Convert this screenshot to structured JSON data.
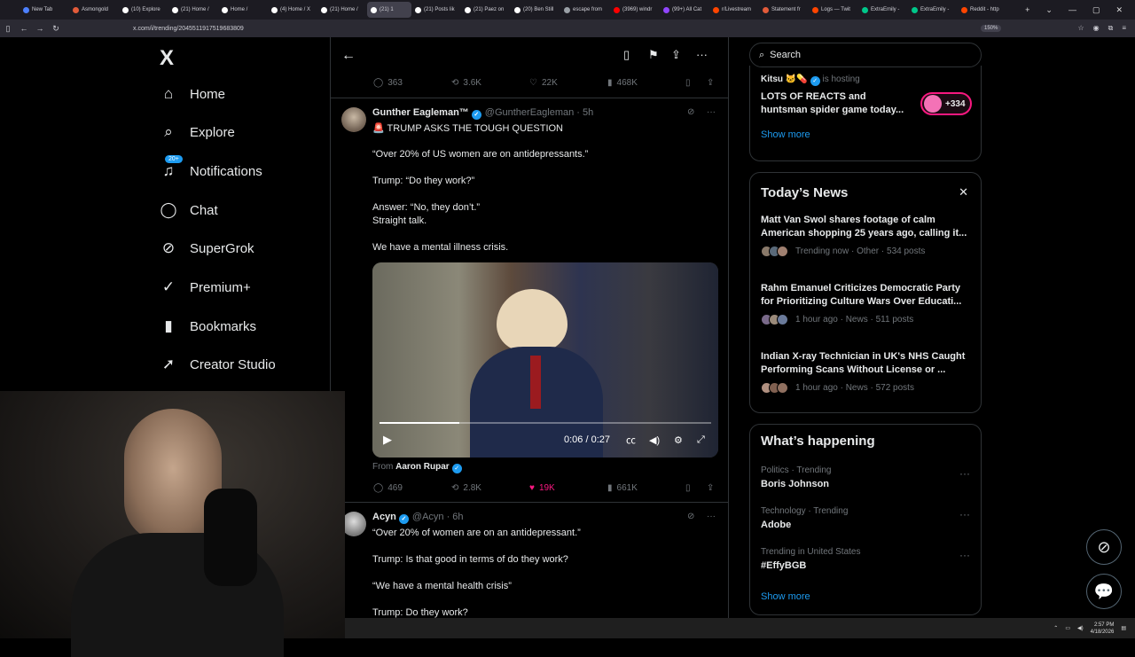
{
  "browser": {
    "tabs": [
      {
        "label": "New Tab",
        "color": "#4d80ff"
      },
      {
        "label": "Asmongold",
        "color": "#e25b3a"
      },
      {
        "label": "(10) Explore",
        "color": "#ffffff"
      },
      {
        "label": "(21) Home /",
        "color": "#ffffff"
      },
      {
        "label": "Home /",
        "color": "#ffffff"
      },
      {
        "label": "(4) Home / X",
        "color": "#ffffff"
      },
      {
        "label": "(21) Home /",
        "color": "#ffffff"
      },
      {
        "label": "(21) 1",
        "color": "#ffffff",
        "active": true
      },
      {
        "label": "(21) Posts lik",
        "color": "#ffffff"
      },
      {
        "label": "(21) Paez on",
        "color": "#ffffff"
      },
      {
        "label": "(20) Ben Still",
        "color": "#ffffff"
      },
      {
        "label": "escape from",
        "color": "#9aa0a6"
      },
      {
        "label": "(3969) windr",
        "color": "#ff0000"
      },
      {
        "label": "(99+) All Cat",
        "color": "#9146ff"
      },
      {
        "label": "r/Livestream",
        "color": "#ff4500"
      },
      {
        "label": "Statement fr",
        "color": "#e25b3a"
      },
      {
        "label": "Logs — Twit",
        "color": "#ff4500"
      },
      {
        "label": "ExtraEmily -",
        "color": "#00c78a"
      },
      {
        "label": "ExtraEmily -",
        "color": "#00c78a"
      },
      {
        "label": "Reddit - http",
        "color": "#ff4500"
      }
    ],
    "url": "x.com/i/trending/2045511917519683809",
    "zoom": "150%"
  },
  "nav": {
    "logo": "X",
    "items": [
      {
        "label": "Home",
        "icon": "home-icon",
        "glyph": "⌂"
      },
      {
        "label": "Explore",
        "icon": "search-icon",
        "glyph": "⌕"
      },
      {
        "label": "Notifications",
        "icon": "bell-icon",
        "glyph": "♫",
        "badge": "20+"
      },
      {
        "label": "Chat",
        "icon": "chat-icon",
        "glyph": "◯"
      },
      {
        "label": "SuperGrok",
        "icon": "grok-icon",
        "glyph": "⊘"
      },
      {
        "label": "Premium+",
        "icon": "premium-icon",
        "glyph": "✓"
      },
      {
        "label": "Bookmarks",
        "icon": "bookmark-icon",
        "glyph": "▮"
      },
      {
        "label": "Creator Studio",
        "icon": "rocket-icon",
        "glyph": "➚"
      }
    ]
  },
  "prev_tweet_stats": {
    "replies": "363",
    "reposts": "3.6K",
    "likes": "22K",
    "views": "468K"
  },
  "tweet1": {
    "name": "Gunther Eagleman™",
    "handle": "@GuntherEagleman · 5h",
    "lines": [
      "🚨 TRUMP ASKS THE TOUGH QUESTION",
      "“Over 20% of US women are on antidepressants.”",
      "Trump: “Do they work?”",
      "Answer: “No, they don’t.”",
      "Straight talk.",
      "We have a mental illness crisis."
    ],
    "video": {
      "time": "0:06 / 0:27",
      "progress": 0.24
    },
    "from_label": "From",
    "from_name": "Aaron Rupar",
    "stats": {
      "replies": "469",
      "reposts": "2.8K",
      "likes": "19K",
      "views": "661K"
    },
    "like_color": "#f91880"
  },
  "tweet2": {
    "name": "Acyn",
    "handle": "@Acyn · 6h",
    "lines": [
      "“Over 20% of women are on an antidepressant.”",
      "Trump: Is that good in terms of do they work?",
      "“We have a mental health crisis”",
      "Trump: Do they work?"
    ]
  },
  "right": {
    "search_placeholder": "Search",
    "live": {
      "host": "Kitsu",
      "hosting": "is hosting",
      "title1": "LOTS OF REACTS and",
      "title2": "huntsman spider game today...",
      "count": "+334",
      "show_more": "Show more"
    },
    "news": {
      "title": "Today’s News",
      "items": [
        {
          "l1": "Matt Van Swol shares footage of calm",
          "l2": "American shopping 25 years ago, calling it...",
          "meta": "Trending now · Other · 534 posts"
        },
        {
          "l1": "Rahm Emanuel Criticizes Democratic Party",
          "l2": "for Prioritizing Culture Wars Over Educati...",
          "meta": "1 hour ago · News · 511 posts"
        },
        {
          "l1": "Indian X-ray Technician in UK's NHS Caught",
          "l2": "Performing Scans Without License or ...",
          "meta": "1 hour ago · News · 572 posts"
        }
      ]
    },
    "happening": {
      "title": "What’s happening",
      "items": [
        {
          "cat": "Politics · Trending",
          "name": "Boris Johnson"
        },
        {
          "cat": "Technology · Trending",
          "name": "Adobe"
        },
        {
          "cat": "Trending in United States",
          "name": "#EffyBGB"
        }
      ],
      "show_more": "Show more"
    }
  },
  "taskbar": {
    "time": "2:57 PM",
    "date": "4/18/2026"
  },
  "accent": "#1d9bf0"
}
